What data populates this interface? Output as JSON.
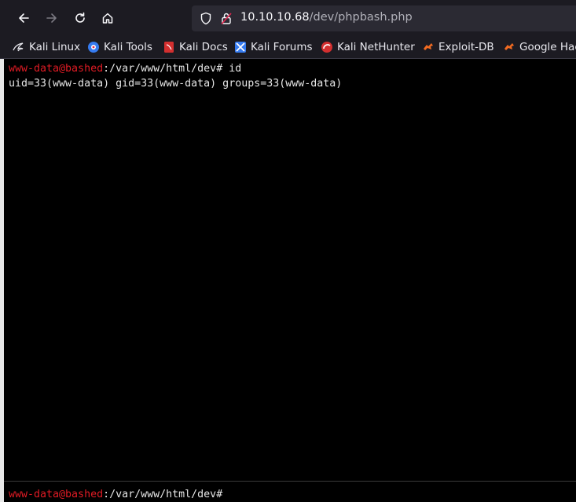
{
  "browser": {
    "url_host": "10.10.10.68",
    "url_path": "/dev/phpbash.php",
    "bookmarks": [
      {
        "label": "Kali Linux",
        "icon": "kali-dragon-icon"
      },
      {
        "label": "Kali Tools",
        "icon": "kali-tools-icon"
      },
      {
        "label": "Kali Docs",
        "icon": "kali-docs-icon"
      },
      {
        "label": "Kali Forums",
        "icon": "kali-forums-icon"
      },
      {
        "label": "Kali NetHunter",
        "icon": "kali-nethunter-icon"
      },
      {
        "label": "Exploit-DB",
        "icon": "exploit-db-icon"
      },
      {
        "label": "Google Hac",
        "icon": "google-hacking-icon"
      }
    ]
  },
  "terminal": {
    "history": [
      {
        "user": "www-data@bashed",
        "path": ":/var/www/html/dev#",
        "command": " id"
      },
      {
        "output": "uid=33(www-data) gid=33(www-data) groups=33(www-data)"
      }
    ],
    "prompt": {
      "user": "www-data@bashed",
      "path": ":/var/www/html/dev#"
    }
  },
  "colors": {
    "prompt_user": "#e01b24",
    "terminal_bg": "#000000",
    "chrome_bg": "#1c1b22"
  }
}
